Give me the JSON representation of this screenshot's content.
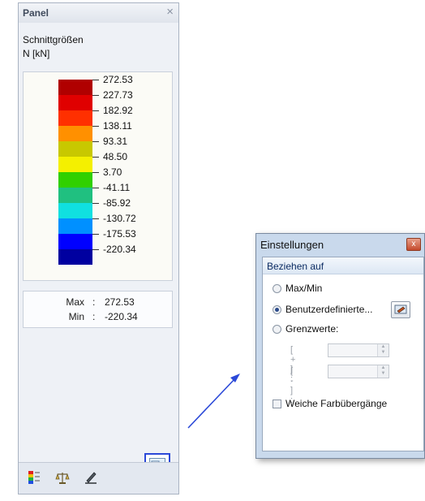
{
  "panel": {
    "title": "Panel",
    "close_glyph": "×",
    "group_label": "Schnittgrößen",
    "unit_label": "N [kN]",
    "legend": [
      {
        "value": "272.53",
        "color": "#b00000"
      },
      {
        "value": "227.73",
        "color": "#e00000"
      },
      {
        "value": "182.92",
        "color": "#ff3000"
      },
      {
        "value": "138.11",
        "color": "#ff9000"
      },
      {
        "value": "93.31",
        "color": "#c8c800"
      },
      {
        "value": "48.50",
        "color": "#f4f000"
      },
      {
        "value": "3.70",
        "color": "#30d000"
      },
      {
        "value": "-41.11",
        "color": "#20c080"
      },
      {
        "value": "-85.92",
        "color": "#10e0e0"
      },
      {
        "value": "-130.72",
        "color": "#0090ff"
      },
      {
        "value": "-175.53",
        "color": "#0000ff"
      },
      {
        "value": "-220.34",
        "color": "#0000a0"
      }
    ],
    "max_label": "Max",
    "max_value": "272.53",
    "min_label": "Min",
    "min_value": "-220.34",
    "colon": ":",
    "footer_icons": [
      "color-scale-icon",
      "balance-icon",
      "pen-icon"
    ]
  },
  "dialog": {
    "title": "Einstellungen",
    "close_glyph": "x",
    "section_title": "Beziehen auf",
    "options": [
      {
        "label": "Max/Min",
        "checked": false
      },
      {
        "label": "Benutzerdefinierte...",
        "checked": true
      },
      {
        "label": "Grenzwerte:",
        "checked": false
      }
    ],
    "limit_plus_label": "[ + ] :",
    "limit_minus_label": "[ - ] :",
    "smooth_label": "Weiche Farbübergänge",
    "smooth_checked": false
  },
  "colors": {
    "highlight": "#2b49d8",
    "arrow": "#2b49d8"
  }
}
